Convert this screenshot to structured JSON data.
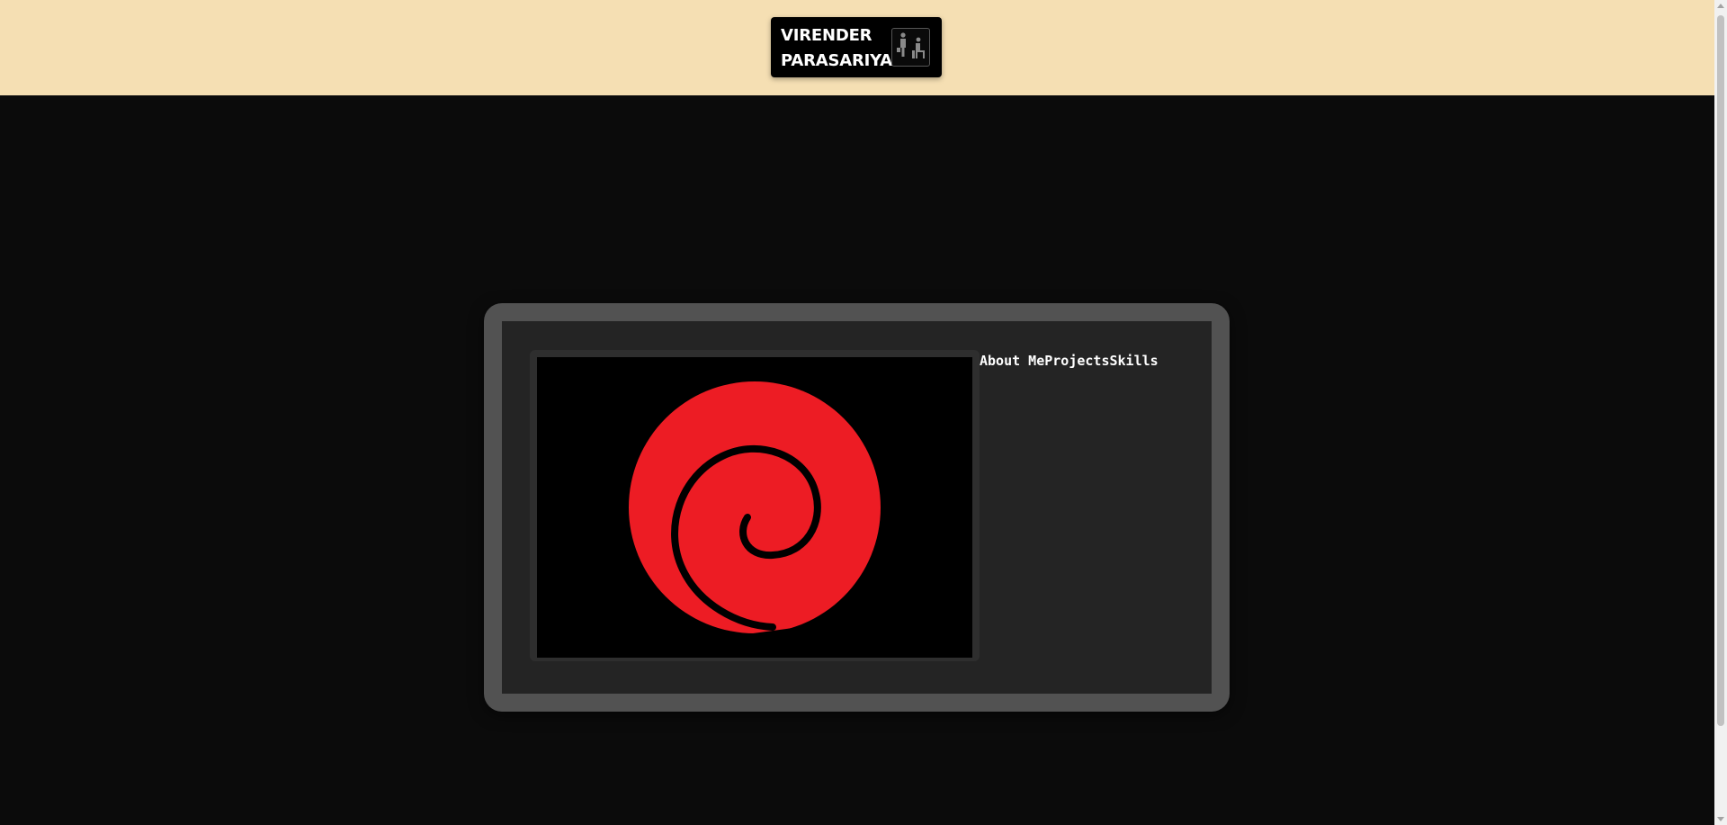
{
  "header": {
    "name_line1": "VIRENDER",
    "name_line2": "PARASARIYA",
    "icon": "people-meeting-icon",
    "background": "#f5dfb3"
  },
  "nav": {
    "items": [
      "About Me",
      "Projects",
      "Skills"
    ]
  },
  "display": {
    "image": "red-spiral-logo",
    "spiral_color": "#ed1c24"
  }
}
